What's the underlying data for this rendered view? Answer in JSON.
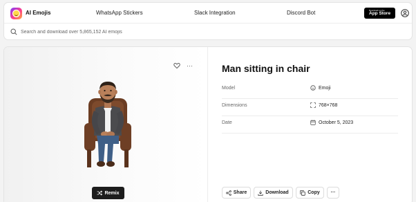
{
  "header": {
    "brand": "AI Emojis",
    "nav": [
      "WhatsApp Stickers",
      "Slack Integration",
      "Discord Bot"
    ],
    "app_store_small": "Download on the",
    "app_store_big": "App Store"
  },
  "search": {
    "placeholder": "Search and download over 5,865,152 AI emojis"
  },
  "emoji": {
    "title": "Man sitting in chair",
    "remix_label": "Remix",
    "details": [
      {
        "key": "Model",
        "value": "Emoji",
        "icon": "emoji-icon"
      },
      {
        "key": "Dimensions",
        "value": "768×768",
        "icon": "expand-icon"
      },
      {
        "key": "Date",
        "value": "October 5, 2023",
        "icon": "calendar-icon"
      }
    ],
    "actions": {
      "share": "Share",
      "download": "Download",
      "copy": "Copy",
      "more": "···"
    },
    "more_top": "···"
  },
  "colors": {
    "accent_dark": "#1d1d1d",
    "border": "#e3e3e3"
  }
}
